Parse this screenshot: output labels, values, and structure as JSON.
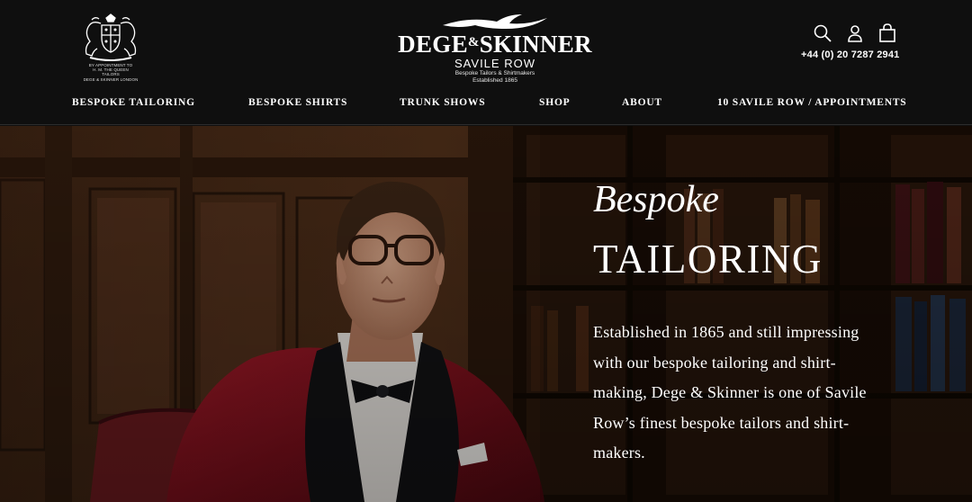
{
  "header": {
    "crest_lines": [
      "BY APPOINTMENT TO",
      "H. M. THE QUEEN",
      "TAILORS",
      "DEGE & SKINNER LONDON"
    ],
    "logo": {
      "name_left": "DEGE",
      "name_amp": "&",
      "name_right": "SKINNER",
      "sub": "SAVILE ROW",
      "tag1": "Bespoke Tailors & Shirtmakers",
      "tag2": "Established 1865"
    },
    "icons": [
      "search-icon",
      "account-icon",
      "bag-icon"
    ],
    "phone": "+44 (0) 20 7287 2941"
  },
  "nav": {
    "items": [
      {
        "label": "BESPOKE TAILORING"
      },
      {
        "label": "BESPOKE SHIRTS"
      },
      {
        "label": "TRUNK SHOWS"
      },
      {
        "label": "SHOP"
      },
      {
        "label": "ABOUT"
      },
      {
        "label": "10 SAVILE ROW / APPOINTMENTS"
      }
    ]
  },
  "hero": {
    "title_italic": "Bespoke",
    "title_caps": "TAILORING",
    "body_lines": [
      "Established in 1865 and still impressing",
      "with our bespoke tailoring and shirt-",
      "making, Dege & Skinner is one of Savile",
      "Row’s finest bespoke tailors and shirt-",
      "makers."
    ]
  },
  "colors": {
    "header_bg": "#0f0f0f",
    "text": "#ffffff",
    "jacket": "#8a1420",
    "wood": "#4a2c18"
  }
}
